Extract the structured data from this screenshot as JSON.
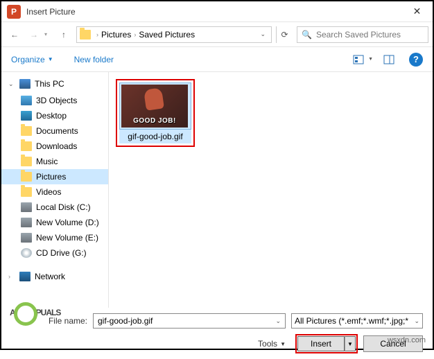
{
  "titlebar": {
    "app_letter": "P",
    "title": "Insert Picture"
  },
  "nav": {
    "breadcrumbs": [
      "Pictures",
      "Saved Pictures"
    ],
    "search_placeholder": "Search Saved Pictures"
  },
  "toolbar": {
    "organize": "Organize",
    "new_folder": "New folder"
  },
  "sidebar": {
    "header": "This PC",
    "items": [
      {
        "label": "3D Objects",
        "icon": "i-3d"
      },
      {
        "label": "Desktop",
        "icon": "i-desktop"
      },
      {
        "label": "Documents",
        "icon": "i-folder"
      },
      {
        "label": "Downloads",
        "icon": "i-folder"
      },
      {
        "label": "Music",
        "icon": "i-folder"
      },
      {
        "label": "Pictures",
        "icon": "i-folder",
        "selected": true
      },
      {
        "label": "Videos",
        "icon": "i-folder"
      },
      {
        "label": "Local Disk (C:)",
        "icon": "i-drive"
      },
      {
        "label": "New Volume (D:)",
        "icon": "i-drive"
      },
      {
        "label": "New Volume (E:)",
        "icon": "i-drive"
      },
      {
        "label": "CD Drive (G:)",
        "icon": "i-cd"
      }
    ],
    "network": "Network"
  },
  "content": {
    "thumb_caption": "GOOD JOB!",
    "thumb_name": "gif-good-job.gif"
  },
  "footer": {
    "filename_label": "File name:",
    "filename_value": "gif-good-job.gif",
    "filter": "All Pictures (*.emf;*.wmf;*.jpg;*",
    "tools": "Tools",
    "insert": "Insert",
    "cancel": "Cancel"
  },
  "watermark": {
    "brand_pre": "A",
    "brand_post": "PUALS",
    "site": "wsxdn.com"
  }
}
